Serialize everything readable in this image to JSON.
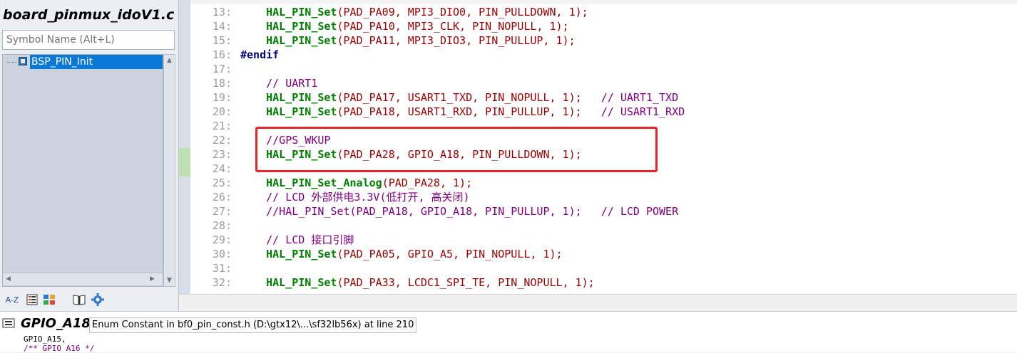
{
  "symbol_panel": {
    "file_title": "board_pinmux_idoV1.c",
    "search_placeholder": "Symbol Name (Alt+L)",
    "symbols": [
      "BSP_PIN_Init"
    ],
    "toolbar_labels": {
      "sort": "A-Z"
    }
  },
  "editor": {
    "lines": [
      {
        "n": "13:",
        "tokens": [
          {
            "t": "    ",
            "c": "plain"
          },
          {
            "t": "HAL_PIN_Set",
            "c": "fn"
          },
          {
            "t": "(PAD_PA09, MPI3_DIO0, PIN_PULLDOWN, 1);",
            "c": "tok"
          }
        ]
      },
      {
        "n": "14:",
        "tokens": [
          {
            "t": "    ",
            "c": "plain"
          },
          {
            "t": "HAL_PIN_Set",
            "c": "fn"
          },
          {
            "t": "(PAD_PA10, MPI3_CLK, PIN_NOPULL, 1);",
            "c": "tok"
          }
        ]
      },
      {
        "n": "15:",
        "tokens": [
          {
            "t": "    ",
            "c": "plain"
          },
          {
            "t": "HAL_PIN_Set",
            "c": "fn"
          },
          {
            "t": "(PAD_PA11, MPI3_DIO3, PIN_PULLUP, 1);",
            "c": "tok"
          }
        ]
      },
      {
        "n": "16:",
        "tokens": [
          {
            "t": "#endif",
            "c": "pp"
          }
        ]
      },
      {
        "n": "17:",
        "tokens": []
      },
      {
        "n": "18:",
        "tokens": [
          {
            "t": "    ",
            "c": "plain"
          },
          {
            "t": "// UART1",
            "c": "cm"
          }
        ]
      },
      {
        "n": "19:",
        "tokens": [
          {
            "t": "    ",
            "c": "plain"
          },
          {
            "t": "HAL_PIN_Set",
            "c": "fn"
          },
          {
            "t": "(PAD_PA17, USART1_TXD, PIN_NOPULL, 1);",
            "c": "tok"
          },
          {
            "t": "   // UART1_TXD",
            "c": "cm"
          }
        ]
      },
      {
        "n": "20:",
        "tokens": [
          {
            "t": "    ",
            "c": "plain"
          },
          {
            "t": "HAL_PIN_Set",
            "c": "fn"
          },
          {
            "t": "(PAD_PA18, USART1_RXD, PIN_PULLUP, 1);",
            "c": "tok"
          },
          {
            "t": "   // USART1_RXD",
            "c": "cm"
          }
        ]
      },
      {
        "n": "21:",
        "tokens": []
      },
      {
        "n": "22:",
        "tokens": [
          {
            "t": "    ",
            "c": "plain"
          },
          {
            "t": "//GPS_WKUP",
            "c": "cm"
          }
        ]
      },
      {
        "n": "23:",
        "tokens": [
          {
            "t": "    ",
            "c": "plain"
          },
          {
            "t": "HAL_PIN_Set",
            "c": "fn"
          },
          {
            "t": "(PAD_PA28, GPIO_A18, PIN_PULLDOWN, 1);",
            "c": "tok"
          }
        ]
      },
      {
        "n": "24:",
        "tokens": []
      },
      {
        "n": "25:",
        "tokens": [
          {
            "t": "    ",
            "c": "plain"
          },
          {
            "t": "HAL_PIN_Set_Analog",
            "c": "fn"
          },
          {
            "t": "(PAD_PA28, 1);",
            "c": "tok"
          }
        ]
      },
      {
        "n": "26:",
        "tokens": [
          {
            "t": "    ",
            "c": "plain"
          },
          {
            "t": "// LCD 外部供电3.3V(低打开, 高关闭)",
            "c": "cm"
          }
        ]
      },
      {
        "n": "27:",
        "tokens": [
          {
            "t": "    ",
            "c": "plain"
          },
          {
            "t": "//HAL_PIN_Set(PAD_PA18, GPIO_A18, PIN_PULLUP, 1);   // LCD POWER",
            "c": "cm"
          }
        ]
      },
      {
        "n": "28:",
        "tokens": []
      },
      {
        "n": "29:",
        "tokens": [
          {
            "t": "    ",
            "c": "plain"
          },
          {
            "t": "// LCD 接口引脚",
            "c": "cm"
          }
        ]
      },
      {
        "n": "30:",
        "tokens": [
          {
            "t": "    ",
            "c": "plain"
          },
          {
            "t": "HAL_PIN_Set",
            "c": "fn"
          },
          {
            "t": "(PAD_PA05, GPIO_A5, PIN_NOPULL, 1);",
            "c": "tok"
          }
        ]
      },
      {
        "n": "31:",
        "tokens": []
      },
      {
        "n": "32:",
        "tokens": [
          {
            "t": "    ",
            "c": "plain"
          },
          {
            "t": "HAL_PIN_Set",
            "c": "fn"
          },
          {
            "t": "(PAD_PA33, LCDC1_SPI_TE, PIN_NOPULL, 1);",
            "c": "tok"
          }
        ]
      }
    ],
    "highlight_color": "#e8252a",
    "change_marker_color": "#bfe0b2"
  },
  "info_bar": {
    "symbol": "GPIO_A18",
    "description": "Enum Constant in bf0_pin_const.h (D:\\gtx12\\...\\sf32lb56x) at line 210",
    "preview": [
      {
        "t": "GPIO_A15,",
        "c": "plain"
      },
      {
        "t": "/** GPIO A16 */",
        "c": "cm"
      }
    ]
  }
}
